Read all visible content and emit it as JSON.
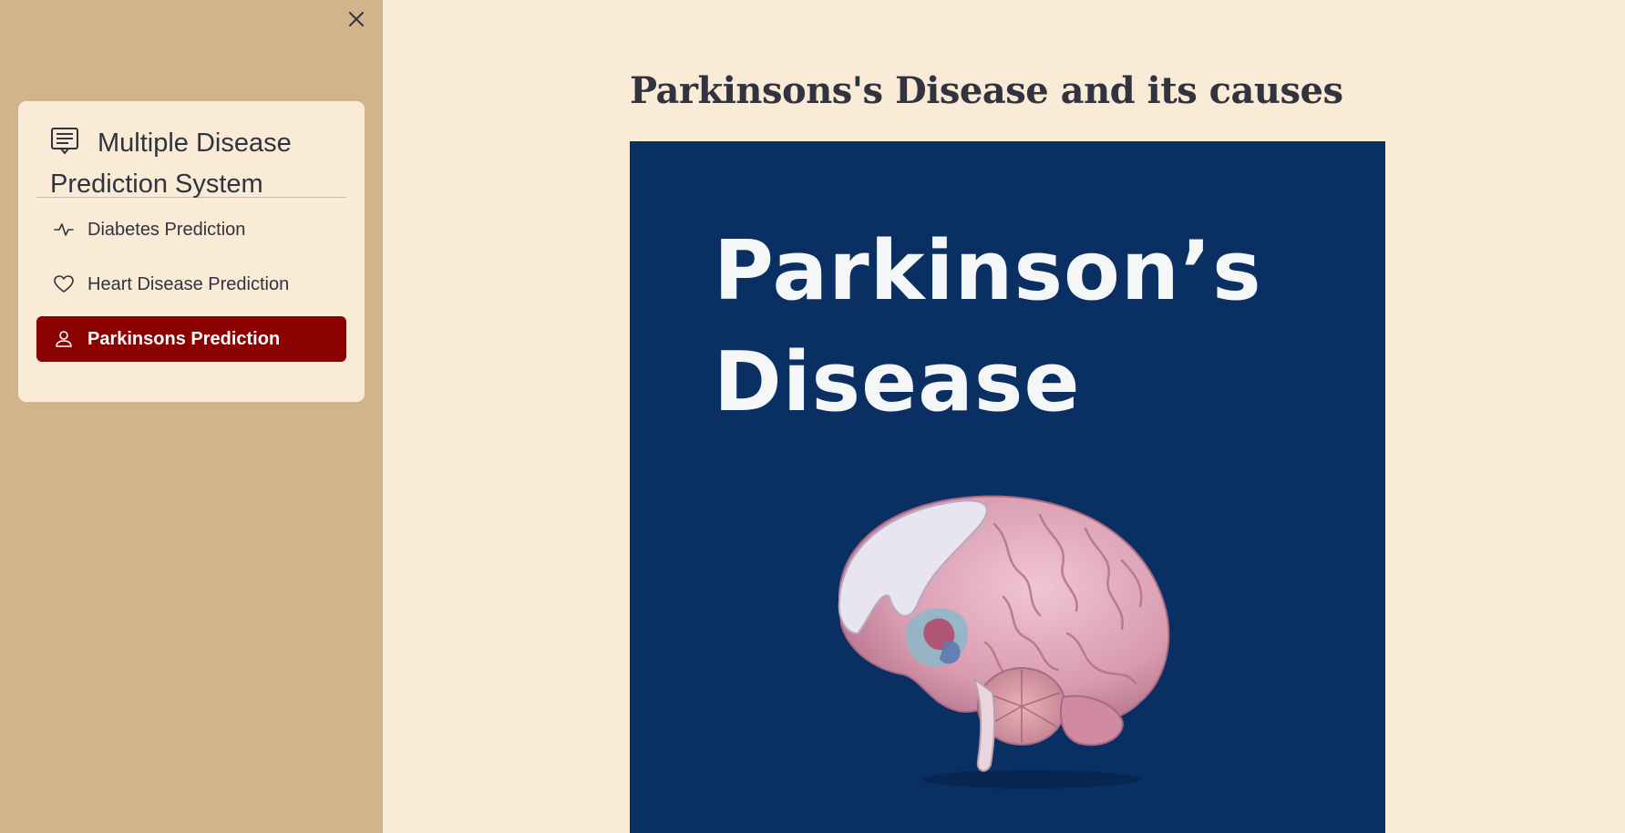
{
  "sidebar": {
    "title": "Multiple Disease Prediction System",
    "title_icon": "document-text-icon",
    "close_icon": "close-icon",
    "items": [
      {
        "label": "Diabetes Prediction",
        "icon": "activity-icon",
        "active": false
      },
      {
        "label": "Heart Disease Prediction",
        "icon": "heart-icon",
        "active": false
      },
      {
        "label": "Parkinsons Prediction",
        "icon": "person-icon",
        "active": true
      }
    ],
    "active_color": "#8b0000",
    "background": "#d2b48c",
    "card_background": "#faebd7"
  },
  "main": {
    "title": "Parkinsons's Disease and its causes",
    "hero": {
      "line1": "Parkinson’s",
      "line2": "Disease",
      "background": "#0a2f63",
      "illustration": "brain-illustration"
    },
    "background": "#faebd7"
  }
}
